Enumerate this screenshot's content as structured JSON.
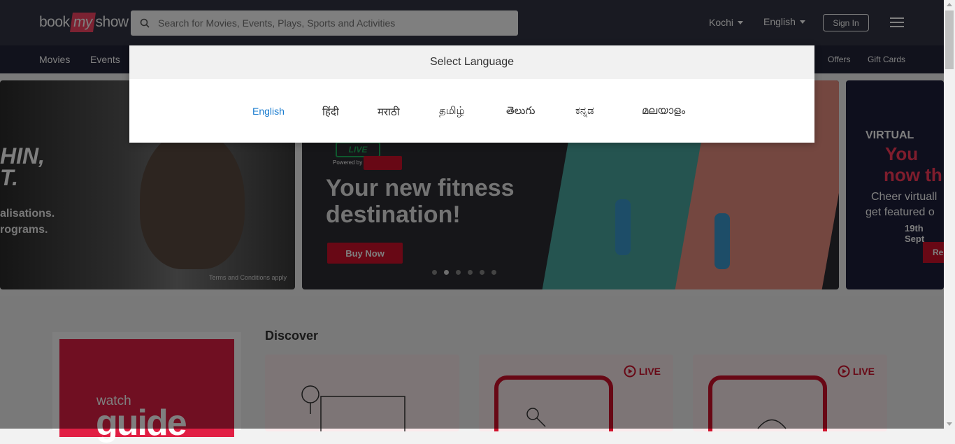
{
  "header": {
    "logo": {
      "part1": "book",
      "part2": "my",
      "part3": "show"
    },
    "search": {
      "placeholder": "Search for Movies, Events, Plays, Sports and Activities"
    },
    "city": "Kochi",
    "language": "English",
    "signin_label": "Sign In"
  },
  "nav": {
    "items": [
      "Movies",
      "Events"
    ],
    "right_items": [
      "Offers",
      "Gift Cards"
    ]
  },
  "banners": {
    "left": {
      "heading_line1": "HIN,",
      "heading_line2": "T.",
      "line1": "alisations.",
      "line2": "rograms.",
      "terms": "Terms and Conditions apply"
    },
    "center": {
      "badge": "LIVE",
      "powered": "Powered by",
      "title_line1": "Your new fitness",
      "title_line2": "destination!",
      "cta": "Buy Now"
    },
    "right": {
      "t1": "VIRTUAL",
      "t2a": "You",
      "t2b": "now th",
      "t3a": "Cheer virtuall",
      "t3b": "get featured o",
      "t4": "19th Sept",
      "cta": "Re"
    }
  },
  "discover": {
    "title": "Discover",
    "live_label": "LIVE"
  },
  "guide": {
    "watch": "watch",
    "big": "guide"
  },
  "modal": {
    "title": "Select Language",
    "languages": [
      "English",
      "हिंदी",
      "मराठी",
      "தமிழ்",
      "తెలుగు",
      "ಕನ್ನಡ",
      "മലയാളം"
    ],
    "selected": "English"
  },
  "colors": {
    "header_bg": "#333545",
    "nav_bg": "#222539",
    "accent": "#f84464",
    "selected_lang": "#1a7ccf"
  }
}
